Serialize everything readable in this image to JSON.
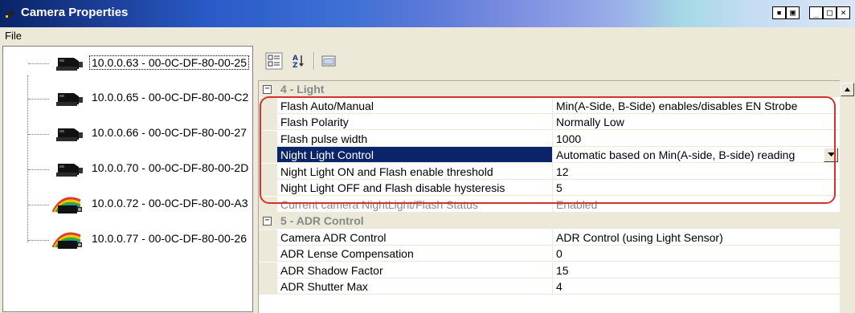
{
  "window": {
    "title": "Camera Properties",
    "controls": [
      "restore",
      "minimize",
      "maximize",
      "close"
    ]
  },
  "menu": {
    "file": "File"
  },
  "tree": {
    "items": [
      {
        "label": "10.0.0.63 - 00-0C-DF-80-00-25",
        "icon": "camera-icon",
        "selected": true
      },
      {
        "label": "10.0.0.65 - 00-0C-DF-80-00-C2",
        "icon": "camera-icon"
      },
      {
        "label": "10.0.0.66 - 00-0C-DF-80-00-27",
        "icon": "camera-icon"
      },
      {
        "label": "10.0.0.70 - 00-0C-DF-80-00-2D",
        "icon": "camera-icon"
      },
      {
        "label": "10.0.0.72 - 00-0C-DF-80-00-A3",
        "icon": "rainbow-camera-icon"
      },
      {
        "label": "10.0.0.77 - 00-0C-DF-80-00-26",
        "icon": "rainbow-camera-icon"
      }
    ]
  },
  "toolbar": {
    "icons": [
      "categorized-icon",
      "alphabetical-sort-icon",
      "property-pages-icon"
    ]
  },
  "grid": {
    "categories": [
      {
        "label": "4 - Light",
        "rows": [
          {
            "name": "Flash Auto/Manual",
            "value": "Min(A-Side, B-Side) enables/disables EN Strobe"
          },
          {
            "name": "Flash Polarity",
            "value": "Normally Low"
          },
          {
            "name": "Flash pulse width",
            "value": "1000"
          },
          {
            "name": "Night Light Control",
            "value": "Automatic based on Min(A-side, B-side) reading",
            "selected": true
          },
          {
            "name": "Night Light ON  and Flash enable threshold",
            "value": "12"
          },
          {
            "name": "Night Light OFF  and Flash disable hysteresis",
            "value": "5"
          },
          {
            "name": "Current camera NightLight/Flash Status",
            "value": "Enabled",
            "readonly": true
          }
        ]
      },
      {
        "label": "5 - ADR Control",
        "rows": [
          {
            "name": "Camera ADR Control",
            "value": "ADR Control (using Light Sensor)"
          },
          {
            "name": "ADR Lense Compensation",
            "value": "0"
          },
          {
            "name": "ADR Shadow Factor",
            "value": "15"
          },
          {
            "name": "ADR Shutter Max",
            "value": "4"
          }
        ]
      }
    ]
  },
  "colors": {
    "selection": "#0a246a",
    "highlight_outline": "#d9302c",
    "category_text": "#888888"
  }
}
